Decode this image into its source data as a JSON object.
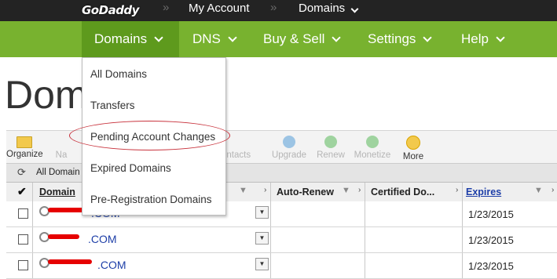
{
  "topbar": {
    "logo": "GoDaddy",
    "breadcrumb": [
      "My Account",
      "Domains"
    ]
  },
  "nav": {
    "items": [
      {
        "label": "Domains"
      },
      {
        "label": "DNS"
      },
      {
        "label": "Buy & Sell"
      },
      {
        "label": "Settings"
      },
      {
        "label": "Help"
      }
    ]
  },
  "page": {
    "title": "Dom"
  },
  "menu": {
    "items": [
      "All Domains",
      "Transfers",
      "Pending Account Changes",
      "Expired Domains",
      "Pre-Registration Domains"
    ],
    "highlighted": "Pending Account Changes"
  },
  "toolbar": {
    "organize": "Organize",
    "partial_na": "Na",
    "partial_contacts": "ontacts",
    "upgrade": "Upgrade",
    "renew": "Renew",
    "monetize": "Monetize",
    "more": "More"
  },
  "filter": {
    "label": "All Domain"
  },
  "table": {
    "columns": [
      "Domain",
      "Auto-Renew",
      "Certified Do...",
      "Expires"
    ],
    "rows": [
      {
        "domain": ".COM",
        "expires": "1/23/2015"
      },
      {
        "domain": ".COM",
        "expires": "1/23/2015"
      },
      {
        "domain": ".COM",
        "expires": "1/23/2015"
      }
    ]
  },
  "colors": {
    "nav": "#78b22f",
    "nav_active": "#5e9a1d",
    "topbar": "#232323",
    "annotation": "#c8323c",
    "redaction": "#e60000"
  }
}
